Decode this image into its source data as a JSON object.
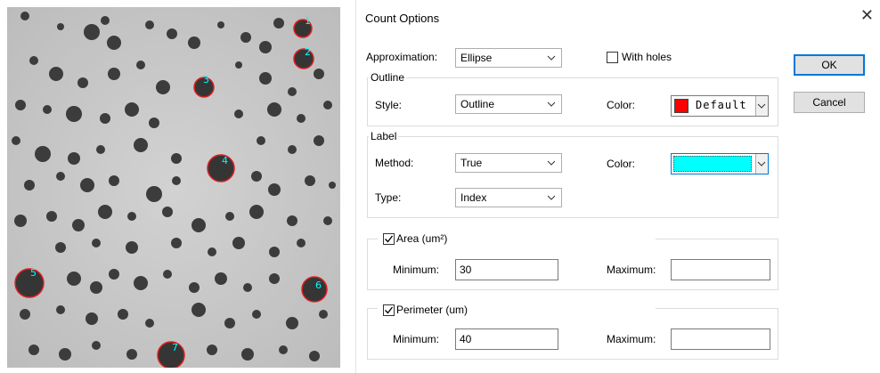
{
  "dialog": {
    "title": "Count Options",
    "close_glyph": "✕",
    "approximation_label": "Approximation:",
    "approximation_value": "Ellipse",
    "with_holes_label": "With holes",
    "with_holes_checked": false,
    "ok_label": "OK",
    "cancel_label": "Cancel"
  },
  "outline": {
    "group_label": "Outline",
    "style_label": "Style:",
    "style_value": "Outline",
    "color_label": "Color:",
    "color_text": "Default",
    "color_hex": "#ff0000"
  },
  "label": {
    "group_label": "Label",
    "method_label": "Method:",
    "method_value": "True",
    "type_label": "Type:",
    "type_value": "Index",
    "color_label": "Color:",
    "color_hex": "#00ffff"
  },
  "area": {
    "label": "Area (um²)",
    "checked": true,
    "minimum_label": "Minimum:",
    "minimum_value": "30",
    "maximum_label": "Maximum:",
    "maximum_value": ""
  },
  "perimeter": {
    "label": "Perimeter (um)",
    "checked": true,
    "minimum_label": "Minimum:",
    "minimum_value": "40",
    "maximum_label": "Maximum:",
    "maximum_value": ""
  },
  "image": {
    "labels": [
      "1",
      "2",
      "3",
      "4",
      "5",
      "6",
      "7"
    ],
    "background_hex": "#c8c8c8",
    "particle_hex": "#3c3c3c",
    "outline_hex": "#e02020",
    "label_hex": "#00ffff"
  }
}
